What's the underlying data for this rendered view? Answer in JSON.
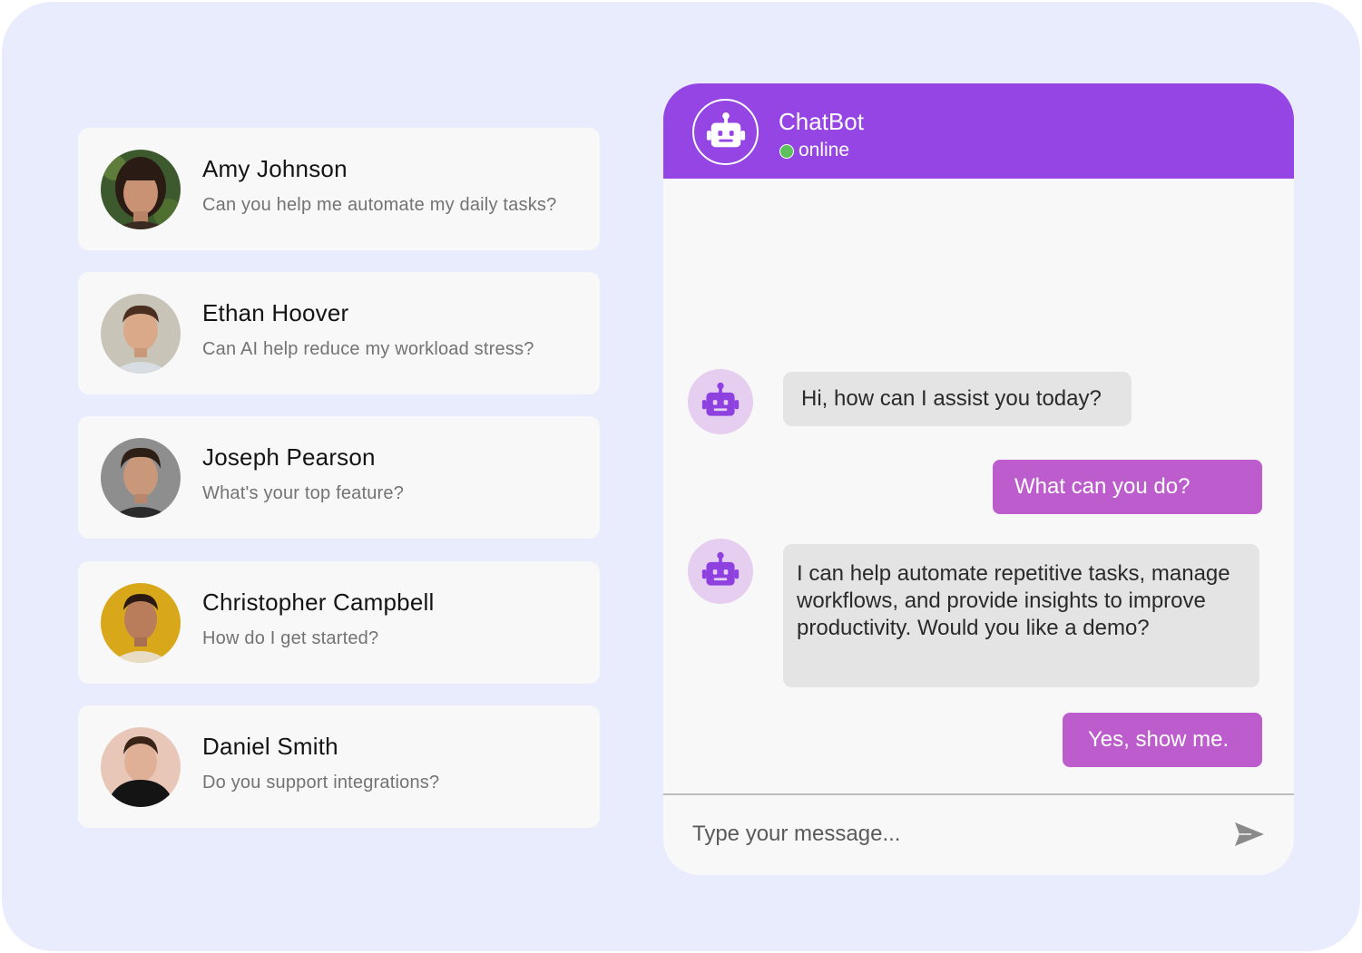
{
  "contacts": [
    {
      "name": "Amy Johnson",
      "preview": "Can you help me automate my daily tasks?",
      "avatar": "avatar-photo-woman"
    },
    {
      "name": "Ethan Hoover",
      "preview": "Can AI help reduce my workload stress?",
      "avatar": "avatar-photo-man"
    },
    {
      "name": "Joseph Pearson",
      "preview": "What's your top feature?",
      "avatar": "avatar-photo-man"
    },
    {
      "name": "Christopher Campbell",
      "preview": "How do I get started?",
      "avatar": "avatar-photo-man"
    },
    {
      "name": "Daniel Smith",
      "preview": "Do you support integrations?",
      "avatar": "avatar-photo-man"
    }
  ],
  "chat": {
    "title": "ChatBot",
    "status": "online",
    "header_icon": "robot-icon",
    "messages": [
      {
        "from": "bot",
        "text": "Hi, how can I assist you today?"
      },
      {
        "from": "user",
        "text": "What can you do?"
      },
      {
        "from": "bot",
        "text": "I can help automate repetitive tasks, manage workflows, and provide insights to improve productivity. Would you like a demo?"
      },
      {
        "from": "user",
        "text": "Yes, show me."
      }
    ],
    "composer": {
      "placeholder": "Type your message...",
      "send_icon": "send-icon"
    }
  },
  "colors": {
    "background": "#e9ecfd",
    "header": "#9545e4",
    "user_bubble": "#bd5dcd",
    "bot_bubble": "#e4e4e4",
    "bot_avatar_bg": "#e5cef0",
    "robot_icon": "#8f41e0",
    "online": "#5cc05c"
  }
}
